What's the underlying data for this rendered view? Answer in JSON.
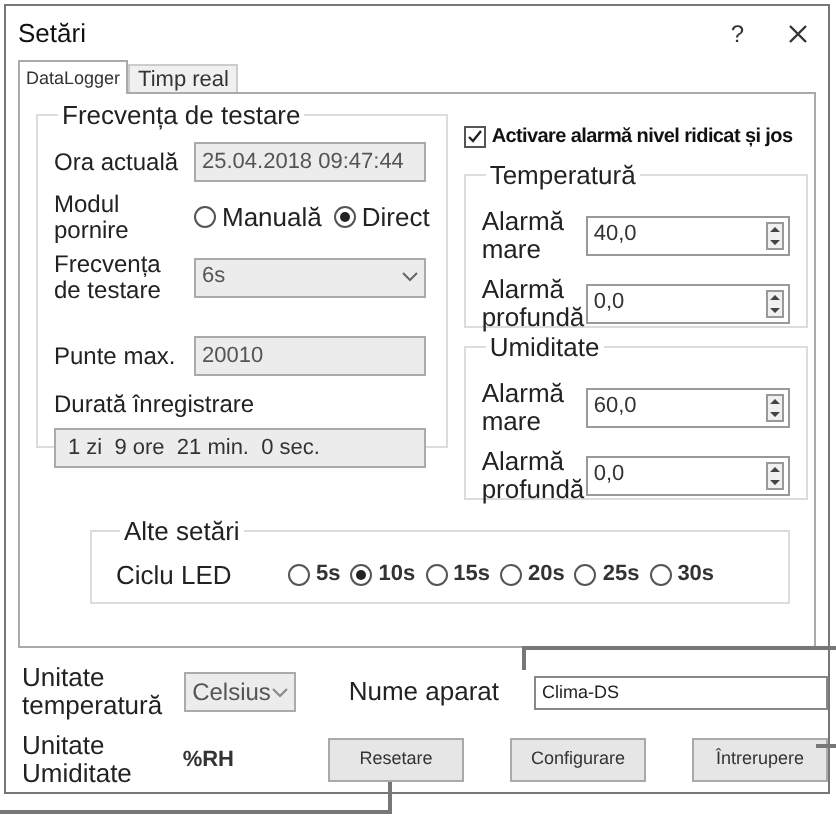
{
  "window": {
    "title": "Setări",
    "help": "?"
  },
  "tabs": [
    {
      "label": "DataLogger",
      "selected": true
    },
    {
      "label": "Timp real",
      "selected": false
    }
  ],
  "sampling": {
    "title": "Frecvența de testare",
    "current_time": {
      "label": "Ora actuală",
      "value": "25.04.2018 09:47:44"
    },
    "start_mode": {
      "label": "Modul pornire",
      "options": [
        {
          "label": "Manuală",
          "selected": false
        },
        {
          "label": "Direct",
          "selected": true
        }
      ]
    },
    "frequency": {
      "label": "Frecvența de testare",
      "value": "6s"
    },
    "max_points": {
      "label": "Punte max.",
      "value": "20010"
    },
    "duration": {
      "label": "Durată înregistrare",
      "value": "1 zi  9 ore  21 min.  0 sec."
    }
  },
  "alarm": {
    "label": "Activare alarmă nivel ridicat și jos",
    "checked": true
  },
  "temperature": {
    "title": "Temperatură",
    "high": {
      "label": "Alarmă mare",
      "value": "40,0"
    },
    "low": {
      "label": "Alarmă profundă",
      "value": "0,0"
    }
  },
  "humidity": {
    "title": "Umiditate",
    "high": {
      "label": "Alarmă mare",
      "value": "60,0"
    },
    "low": {
      "label": "Alarmă profundă",
      "value": "0,0"
    }
  },
  "other": {
    "title": "Alte setări",
    "led": {
      "label": "Ciclu LED",
      "options": [
        {
          "label": "5s",
          "selected": false
        },
        {
          "label": "10s",
          "selected": true
        },
        {
          "label": "15s",
          "selected": false
        },
        {
          "label": "20s",
          "selected": false
        },
        {
          "label": "25s",
          "selected": false
        },
        {
          "label": "30s",
          "selected": false
        }
      ]
    }
  },
  "temp_unit": {
    "label": "Unitate temperatură",
    "value": "Celsius"
  },
  "device_name": {
    "label": "Nume aparat",
    "value": "Clima-DS"
  },
  "humidity_unit": {
    "label": "Unitate Umiditate",
    "value": "%RH"
  },
  "buttons": [
    "Resetare",
    "Configurare",
    "Întrerupere"
  ]
}
